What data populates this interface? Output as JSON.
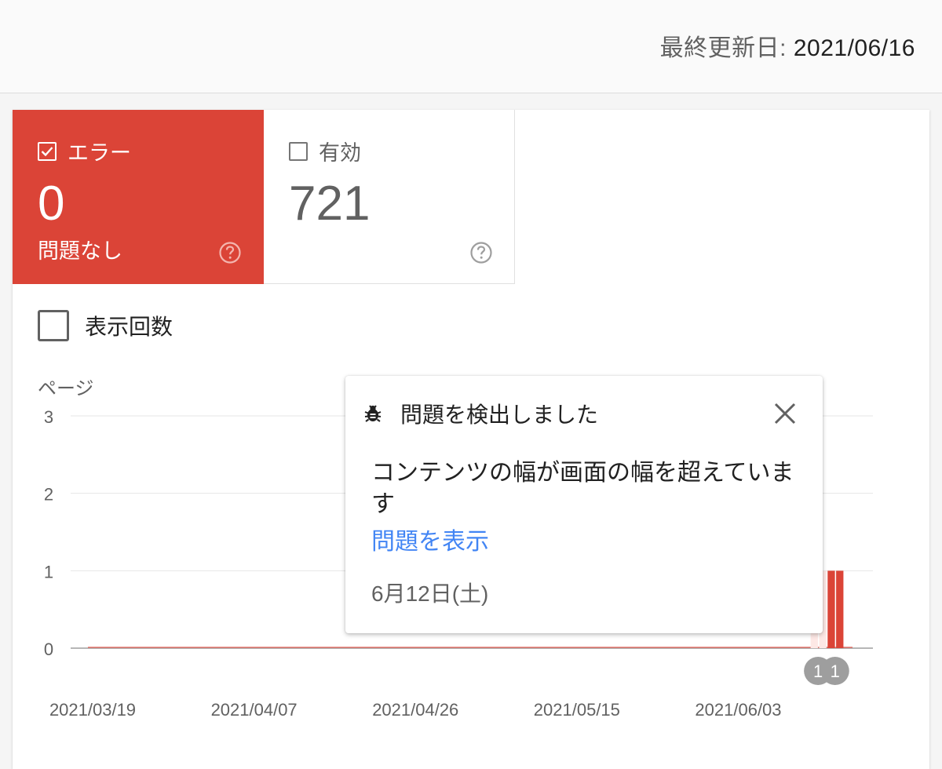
{
  "header": {
    "last_updated_label": "最終更新日:",
    "last_updated_value": "2021/06/16"
  },
  "tiles": {
    "error": {
      "label": "エラー",
      "count": "0",
      "subtitle": "問題なし",
      "selected": true,
      "color": "#db4437"
    },
    "valid": {
      "label": "有効",
      "count": "721",
      "selected": false
    }
  },
  "impressions": {
    "label": "表示回数",
    "checked": false
  },
  "chart_data": {
    "type": "bar",
    "ylabel": "ページ",
    "ylim": [
      0,
      3
    ],
    "yticks": [
      "0",
      "1",
      "2",
      "3"
    ],
    "x_tick_labels": [
      "2021/03/19",
      "2021/04/07",
      "2021/04/26",
      "2021/05/15",
      "2021/06/03"
    ],
    "x_start": "2021/03/19",
    "x_end": "2021/06/16",
    "series": [
      {
        "color": "#db4437",
        "points": [
          {
            "date": "2021/06/12",
            "value": 1,
            "highlighted": true
          },
          {
            "date": "2021/06/13",
            "value": 1,
            "highlighted": true
          },
          {
            "date": "2021/06/14",
            "value": 1
          },
          {
            "date": "2021/06/15",
            "value": 1
          }
        ]
      }
    ],
    "annotations": [
      {
        "date": "2021/06/13",
        "label": "1"
      },
      {
        "date": "2021/06/15",
        "label": "1"
      }
    ]
  },
  "tooltip": {
    "title": "問題を検出しました",
    "message": "コンテンツの幅が画面の幅を超えています",
    "link": "問題を表示",
    "date": "6月12日(土)"
  }
}
